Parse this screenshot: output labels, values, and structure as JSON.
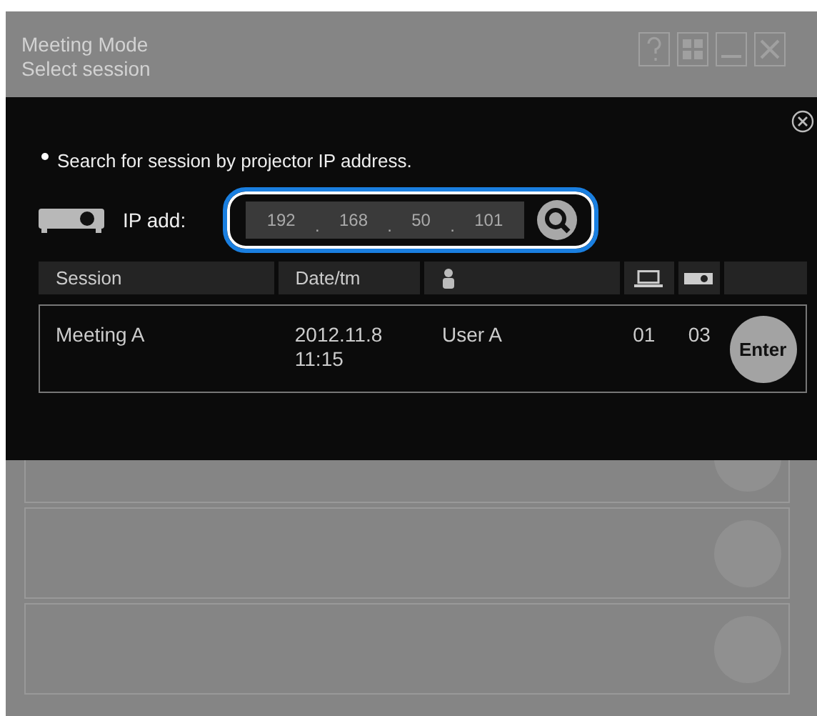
{
  "window": {
    "title": "Meeting Mode",
    "subtitle": "Select session"
  },
  "dialog": {
    "instruction": "Search for session by projector IP address.",
    "ip_label": "IP add:",
    "ip_octets": [
      "192",
      "168",
      "50",
      "101"
    ],
    "ip_separator": ".",
    "columns": [
      "Session",
      "Date/tm"
    ],
    "rows": [
      {
        "session": "Meeting A",
        "date": "2012.11.8",
        "time": "11:15",
        "user": "User A",
        "pcs": "01",
        "projectors": "03",
        "action": "Enter"
      }
    ]
  }
}
